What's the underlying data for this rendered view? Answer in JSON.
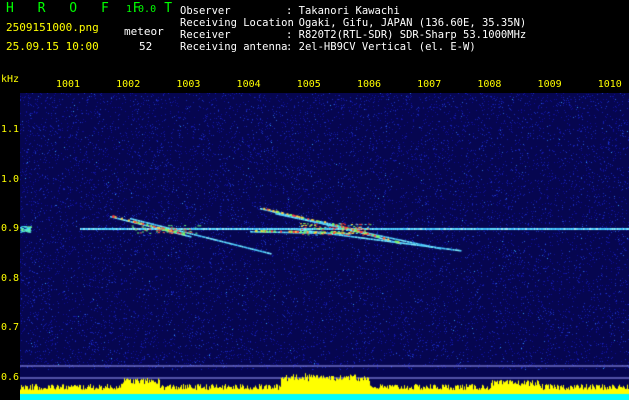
{
  "header": {
    "app_title": "H R O F F T",
    "version": "1.0.0",
    "filename": "2509151000.png",
    "timestamp": "25.09.15 10:00",
    "meteor_label": "meteor",
    "meteor_count": "52"
  },
  "info": {
    "observer_label": "Observer",
    "observer_value": ": Takanori Kawachi",
    "location_label": "Receiving Location",
    "location_value": ": Ogaki, Gifu, JAPAN (136.60E, 35.35N)",
    "receiver_label": "Receiver",
    "receiver_value": ": R820T2(RTL-SDR) SDR-Sharp 53.1000MHz",
    "antenna_label": "Receiving antenna",
    "antenna_value": ": 2el-HB9CV Vertical (el. E-W)"
  },
  "plot": {
    "y_unit": "kHz",
    "y_ticks": [
      "1.1",
      "1.0",
      "0.9",
      "0.8",
      "0.7",
      "0.6"
    ],
    "y_tick_values": [
      1.1,
      1.0,
      0.9,
      0.8,
      0.7,
      0.6
    ],
    "x_ticks": [
      "1001",
      "1002",
      "1003",
      "1004",
      "1005",
      "1006",
      "1007",
      "1008",
      "1009",
      "1010"
    ],
    "colors": {
      "background": "#0a0a6e",
      "carrier": "#60e0ff",
      "meteor_hot": "#ff4040",
      "label": "#ffff00",
      "bottom_bar": "#ffff00",
      "base_line": "#00ffff"
    }
  }
}
